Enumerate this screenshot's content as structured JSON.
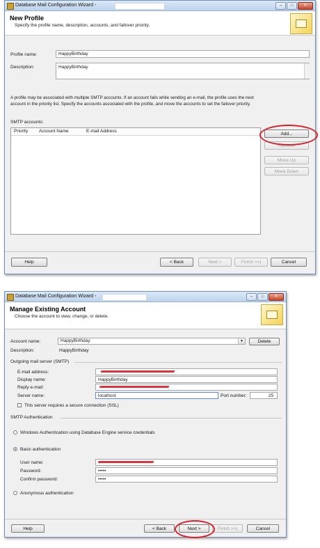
{
  "window1": {
    "title": "Database Mail Configuration Wizard -",
    "header_title": "New Profile",
    "header_subtitle": "Specify the profile name, description, accounts, and failover priority.",
    "profile_name_label": "Profile name:",
    "profile_name_value": "HappyBirthday",
    "description_label": "Description:",
    "description_value": "HappyBirthday",
    "info_text_1": "A profile may be associated with multiple SMTP accounts. If an account fails while sending an e-mail, the profile uses the next",
    "info_text_2": "account in the priority list. Specify the accounts associated with the profile, and move the accounts to set the failover priority.",
    "smtp_accounts_label": "SMTP accounts:",
    "columns": [
      "Priority",
      "Account Name",
      "E-mail Address"
    ],
    "add_label": "Add...",
    "remove_label": "Remove",
    "move_up_label": "Move Up",
    "move_down_label": "Move Down",
    "help_label": "Help",
    "back_label": "< Back",
    "next_label": "Next >",
    "finish_label": "Finish >>|",
    "cancel_label": "Cancel"
  },
  "window2": {
    "title": "Database Mail Configuration Wizard -",
    "header_title": "Manage Existing Account",
    "header_subtitle": "Choose the account to view, change, or delete.",
    "account_name_label": "Account name:",
    "account_name_value": "HappyBirthday",
    "delete_label": "Delete",
    "description_label": "Description:",
    "description_value": "HappyBirthday",
    "outgoing_label": "Outgoing mail server (SMTP)",
    "email_label": "E-mail address:",
    "display_name_label": "Display name:",
    "display_name_value": "HappyBirthday",
    "reply_email_label": "Reply e-mail:",
    "server_name_label": "Server name:",
    "server_name_value": "localhost",
    "port_label": "Port number:",
    "port_value": "25",
    "ssl_label": "This server requires a secure connection (SSL)",
    "smtp_auth_label": "SMTP Authentication",
    "windows_auth_label": "Windows Authentication using Database Engine service credentials",
    "basic_auth_label": "Basic authentication",
    "user_name_label": "User name:",
    "password_label": "Password:",
    "password_value": "•••••",
    "confirm_password_label": "Confirm password:",
    "confirm_password_value": "•••••",
    "anonymous_label": "Anonymous authentication",
    "help_label": "Help",
    "back_label": "< Back",
    "next_label": "Next >",
    "finish_label": "Finish >>|",
    "cancel_label": "Cancel"
  },
  "window_controls": {
    "minimize": "–",
    "maximize": "□",
    "close": "✕"
  },
  "colors": {
    "annotation_red": "#d8202a",
    "title_bar": "#bdd3ec"
  }
}
